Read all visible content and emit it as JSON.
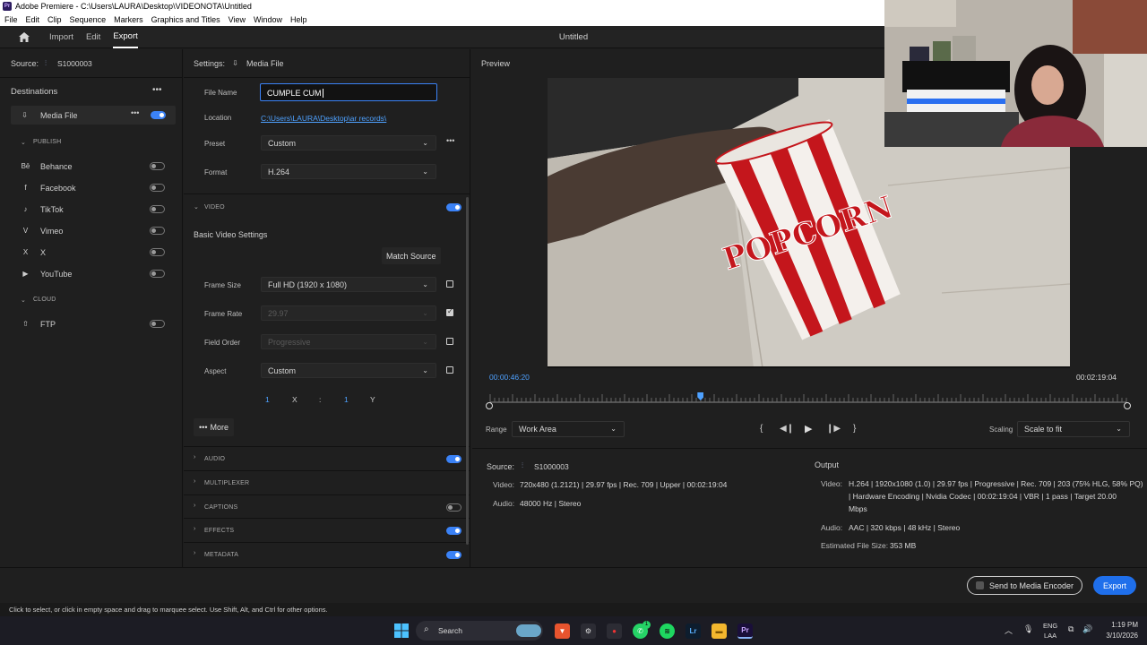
{
  "window": {
    "app_logo": "Pr",
    "title": "Adobe Premiere - C:\\Users\\LAURA\\Desktop\\VIDEONOTA\\Untitled"
  },
  "menu": [
    "File",
    "Edit",
    "Clip",
    "Sequence",
    "Markers",
    "Graphics and Titles",
    "View",
    "Window",
    "Help"
  ],
  "header": {
    "tabs": [
      "Import",
      "Edit",
      "Export"
    ],
    "active_tab": "Export",
    "document_title": "Untitled"
  },
  "left": {
    "source_label": "Source:",
    "source_name": "S1000003",
    "destinations_title": "Destinations",
    "media_file": "Media File",
    "publish_label": "PUBLISH",
    "publish_items": [
      "Behance",
      "Facebook",
      "TikTok",
      "Vimeo",
      "X",
      "YouTube"
    ],
    "publish_icons": [
      "Bē",
      "f",
      "♪",
      "V",
      "X",
      "▶"
    ],
    "cloud_label": "CLOUD",
    "cloud_items": [
      "FTP"
    ]
  },
  "settings": {
    "title": "Settings:",
    "target": "Media File",
    "file_name_label": "File Name",
    "file_name_value": "CUMPLE CUM",
    "location_label": "Location",
    "location_value": "C:\\Users\\LAURA\\Desktop\\ar records\\",
    "preset_label": "Preset",
    "preset_value": "Custom",
    "format_label": "Format",
    "format_value": "H.264",
    "video_section": "VIDEO",
    "basic_video_settings": "Basic Video Settings",
    "match_source": "Match Source",
    "frame_size_label": "Frame Size",
    "frame_size_value": "Full HD (1920 x 1080)",
    "frame_rate_label": "Frame Rate",
    "frame_rate_value": "29.97",
    "field_order_label": "Field Order",
    "field_order_value": "Progressive",
    "aspect_label": "Aspect",
    "aspect_value": "Custom",
    "aspect_x": "1",
    "aspect_x_label": "X",
    "aspect_sep": ":",
    "aspect_y": "1",
    "aspect_y_label": "Y",
    "more": "More",
    "sections": [
      "AUDIO",
      "MULTIPLEXER",
      "CAPTIONS",
      "EFFECTS",
      "METADATA"
    ]
  },
  "preview": {
    "title": "Preview",
    "current_time": "00:00:46:20",
    "end_time": "00:02:19:04",
    "range_label": "Range",
    "range_value": "Work Area",
    "scaling_label": "Scaling",
    "scaling_value": "Scale to fit",
    "cup_text": "POPCORN",
    "playhead_fraction": 0.33
  },
  "source_info": {
    "label": "Source:",
    "name": "S1000003",
    "video_label": "Video:",
    "video_value": "720x480 (1.2121)  |  29.97 fps  |  Rec. 709  |  Upper  |  00:02:19:04",
    "audio_label": "Audio:",
    "audio_value": "48000 Hz  |  Stereo"
  },
  "output_info": {
    "title": "Output",
    "video_label": "Video:",
    "video_line1": "H.264  |  1920x1080 (1.0)  |  29.97 fps  |  Progressive  |  Rec. 709  |  203 (75% HLG, 58% PQ)",
    "video_line2": "|  Hardware Encoding  |  Nvidia Codec  |  00:02:19:04  |  VBR  |  1 pass  |  Target 20.00",
    "video_line3": "Mbps",
    "audio_label": "Audio:",
    "audio_value": "AAC  |  320 kbps  |  48 kHz  |  Stereo",
    "file_size_label": "Estimated File Size:",
    "file_size_value": "353 MB"
  },
  "bottom": {
    "send_button": "Send to Media Encoder",
    "export_button": "Export"
  },
  "status": "Click to select, or click in empty space and drag to marquee select. Use Shift, Alt, and Ctrl for other options.",
  "taskbar": {
    "search": "Search",
    "lang1": "ENG",
    "lang2": "LAA",
    "time": "1:19 PM",
    "date": "3/10/2026",
    "whatsapp_badge": "1",
    "icons": {
      "lightroom": "Lr",
      "premiere": "Pr"
    }
  },
  "colors": {
    "accent": "#3b82f6",
    "panel": "#1f1f1f",
    "link": "#4ea1ff"
  }
}
